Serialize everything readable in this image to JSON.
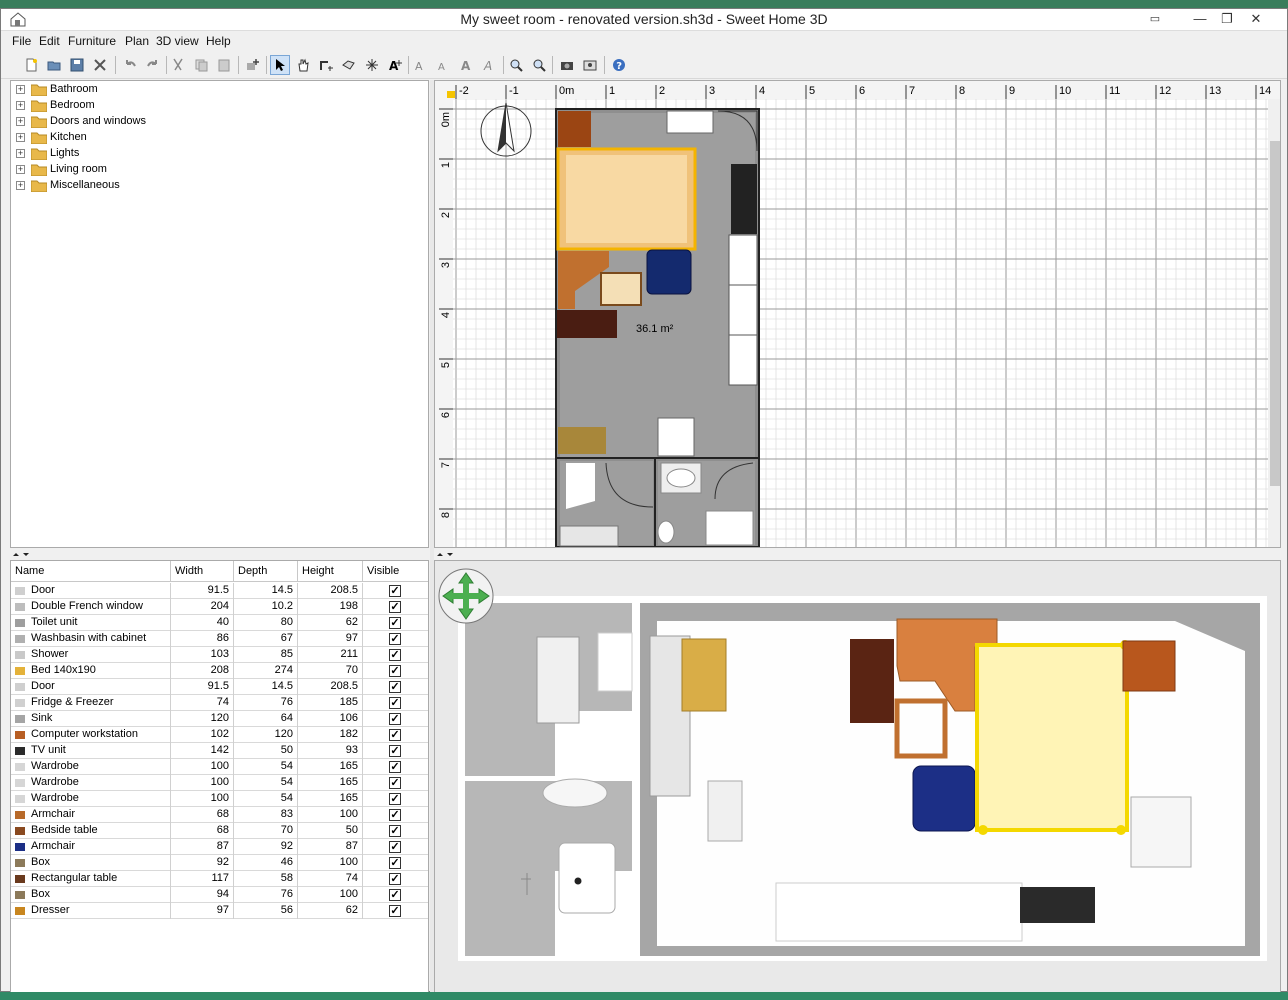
{
  "window": {
    "title": "My sweet room - renovated version.sh3d - Sweet Home 3D",
    "controls": [
      "□",
      "—",
      "❐",
      "✕"
    ]
  },
  "menu": [
    "File",
    "Edit",
    "Furniture",
    "Plan",
    "3D view",
    "Help"
  ],
  "toolbar": {
    "buttons": [
      "new-home",
      "open",
      "save",
      "cut-preferences",
      "undo",
      "redo",
      "cut",
      "copy",
      "paste",
      "add-furniture",
      "select-mode",
      "pan-mode",
      "create-walls",
      "create-rooms",
      "create-dimensions",
      "create-labels",
      "increase-text",
      "decrease-text",
      "bold-text",
      "italic-text",
      "zoom-in",
      "zoom-out",
      "create-photo",
      "create-video",
      "help"
    ],
    "active": "select-mode"
  },
  "catalog": {
    "categories": [
      "Bathroom",
      "Bedroom",
      "Doors and windows",
      "Kitchen",
      "Lights",
      "Living room",
      "Miscellaneous"
    ]
  },
  "furniture_table": {
    "columns": [
      "Name",
      "Width",
      "Depth",
      "Height",
      "Visible"
    ],
    "rows": [
      {
        "name": "Door",
        "width": "91.5",
        "depth": "14.5",
        "height": "208.5",
        "visible": true,
        "icon": "door-icon"
      },
      {
        "name": "Double French window",
        "width": "204",
        "depth": "10.2",
        "height": "198",
        "visible": true,
        "icon": "window-icon"
      },
      {
        "name": "Toilet unit",
        "width": "40",
        "depth": "80",
        "height": "62",
        "visible": true,
        "icon": "toilet-icon"
      },
      {
        "name": "Washbasin with cabinet",
        "width": "86",
        "depth": "67",
        "height": "97",
        "visible": true,
        "icon": "washbasin-icon"
      },
      {
        "name": "Shower",
        "width": "103",
        "depth": "85",
        "height": "211",
        "visible": true,
        "icon": "shower-icon"
      },
      {
        "name": "Bed 140x190",
        "width": "208",
        "depth": "274",
        "height": "70",
        "visible": true,
        "icon": "bed-icon"
      },
      {
        "name": "Door",
        "width": "91.5",
        "depth": "14.5",
        "height": "208.5",
        "visible": true,
        "icon": "door-icon"
      },
      {
        "name": "Fridge & Freezer",
        "width": "74",
        "depth": "76",
        "height": "185",
        "visible": true,
        "icon": "fridge-icon"
      },
      {
        "name": "Sink",
        "width": "120",
        "depth": "64",
        "height": "106",
        "visible": true,
        "icon": "sink-icon"
      },
      {
        "name": "Computer workstation",
        "width": "102",
        "depth": "120",
        "height": "182",
        "visible": true,
        "icon": "workstation-icon"
      },
      {
        "name": "TV unit",
        "width": "142",
        "depth": "50",
        "height": "93",
        "visible": true,
        "icon": "tv-icon"
      },
      {
        "name": "Wardrobe",
        "width": "100",
        "depth": "54",
        "height": "165",
        "visible": true,
        "icon": "wardrobe-icon"
      },
      {
        "name": "Wardrobe",
        "width": "100",
        "depth": "54",
        "height": "165",
        "visible": true,
        "icon": "wardrobe-icon"
      },
      {
        "name": "Wardrobe",
        "width": "100",
        "depth": "54",
        "height": "165",
        "visible": true,
        "icon": "wardrobe-icon"
      },
      {
        "name": "Armchair",
        "width": "68",
        "depth": "83",
        "height": "100",
        "visible": true,
        "icon": "armchair-icon"
      },
      {
        "name": "Bedside table",
        "width": "68",
        "depth": "70",
        "height": "50",
        "visible": true,
        "icon": "bedside-table-icon"
      },
      {
        "name": "Armchair",
        "width": "87",
        "depth": "92",
        "height": "87",
        "visible": true,
        "icon": "armchair-blue-icon"
      },
      {
        "name": "Box",
        "width": "92",
        "depth": "46",
        "height": "100",
        "visible": true,
        "icon": "box-icon"
      },
      {
        "name": "Rectangular table",
        "width": "117",
        "depth": "58",
        "height": "74",
        "visible": true,
        "icon": "table-icon"
      },
      {
        "name": "Box",
        "width": "94",
        "depth": "76",
        "height": "100",
        "visible": true,
        "icon": "box-icon"
      },
      {
        "name": "Dresser",
        "width": "97",
        "depth": "56",
        "height": "62",
        "visible": true,
        "icon": "dresser-icon"
      }
    ]
  },
  "plan": {
    "ruler_x": [
      "-2",
      "-1",
      "0m",
      "1",
      "2",
      "3",
      "4",
      "5",
      "6",
      "7",
      "8",
      "9",
      "10",
      "11",
      "12",
      "13",
      "14"
    ],
    "ruler_y": [
      "0m",
      "1",
      "2",
      "3",
      "4",
      "5",
      "6",
      "7",
      "8"
    ],
    "room_area": "36.1 m²"
  },
  "colors": {
    "selection": "#f4b400",
    "grid": "#c8c8c8",
    "room_floor": "#9a9a9a",
    "navigation": "#4caf50"
  }
}
